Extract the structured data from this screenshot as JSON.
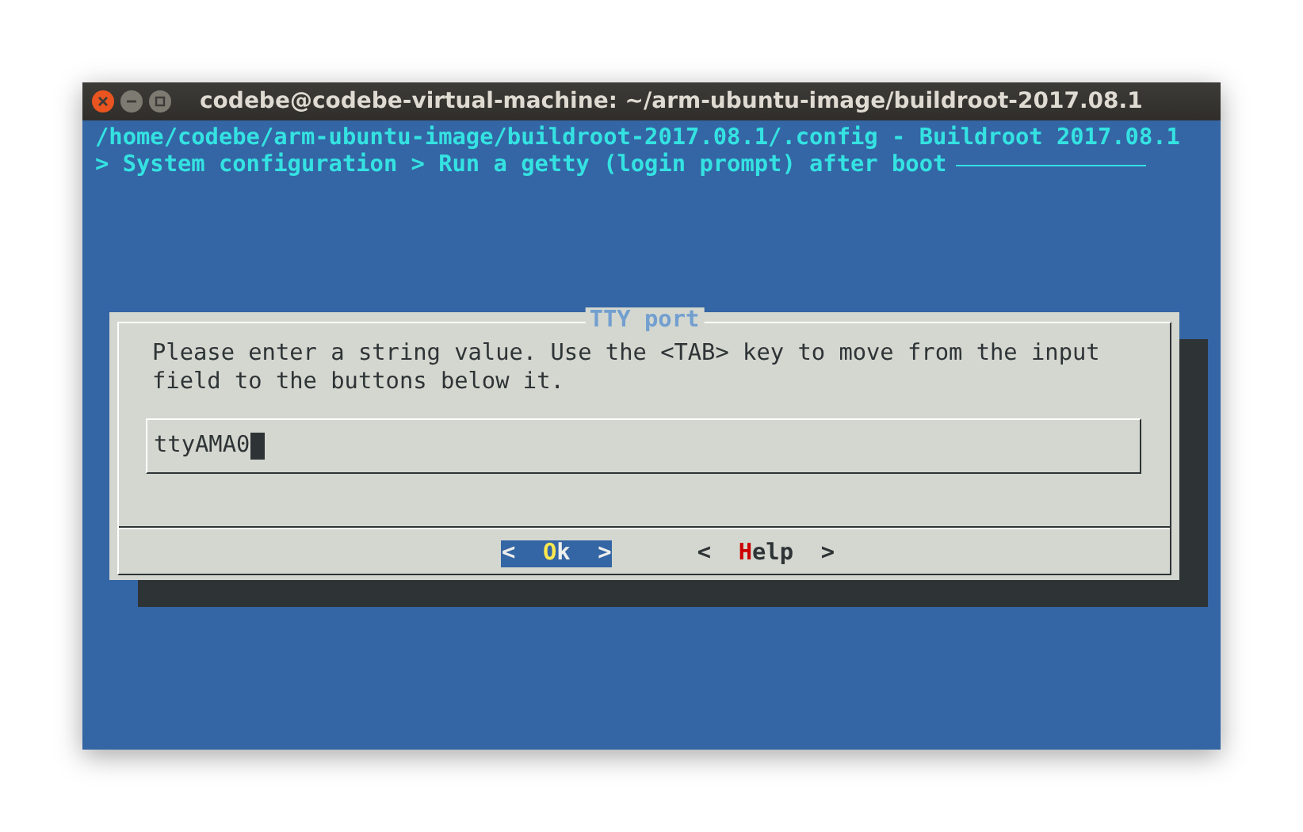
{
  "window": {
    "title": "codebe@codebe-virtual-machine: ~/arm-ubuntu-image/buildroot-2017.08.1"
  },
  "header": {
    "path": "/home/codebe/arm-ubuntu-image/buildroot-2017.08.1/.config - Buildroot 2017.08.1",
    "breadcrumb": "> System configuration > Run a getty (login prompt) after boot"
  },
  "dialog": {
    "title": "TTY port",
    "message": "Please enter a string value. Use the <TAB> key to move from the input field to the buttons below it.",
    "value": "ttyAMA0",
    "buttons": [
      {
        "open": "<",
        "hotkey": "O",
        "rest": "k",
        "close": ">",
        "selected": true
      },
      {
        "open": "<",
        "hotkey": "H",
        "rest": "elp",
        "close": ">",
        "selected": false
      }
    ]
  }
}
